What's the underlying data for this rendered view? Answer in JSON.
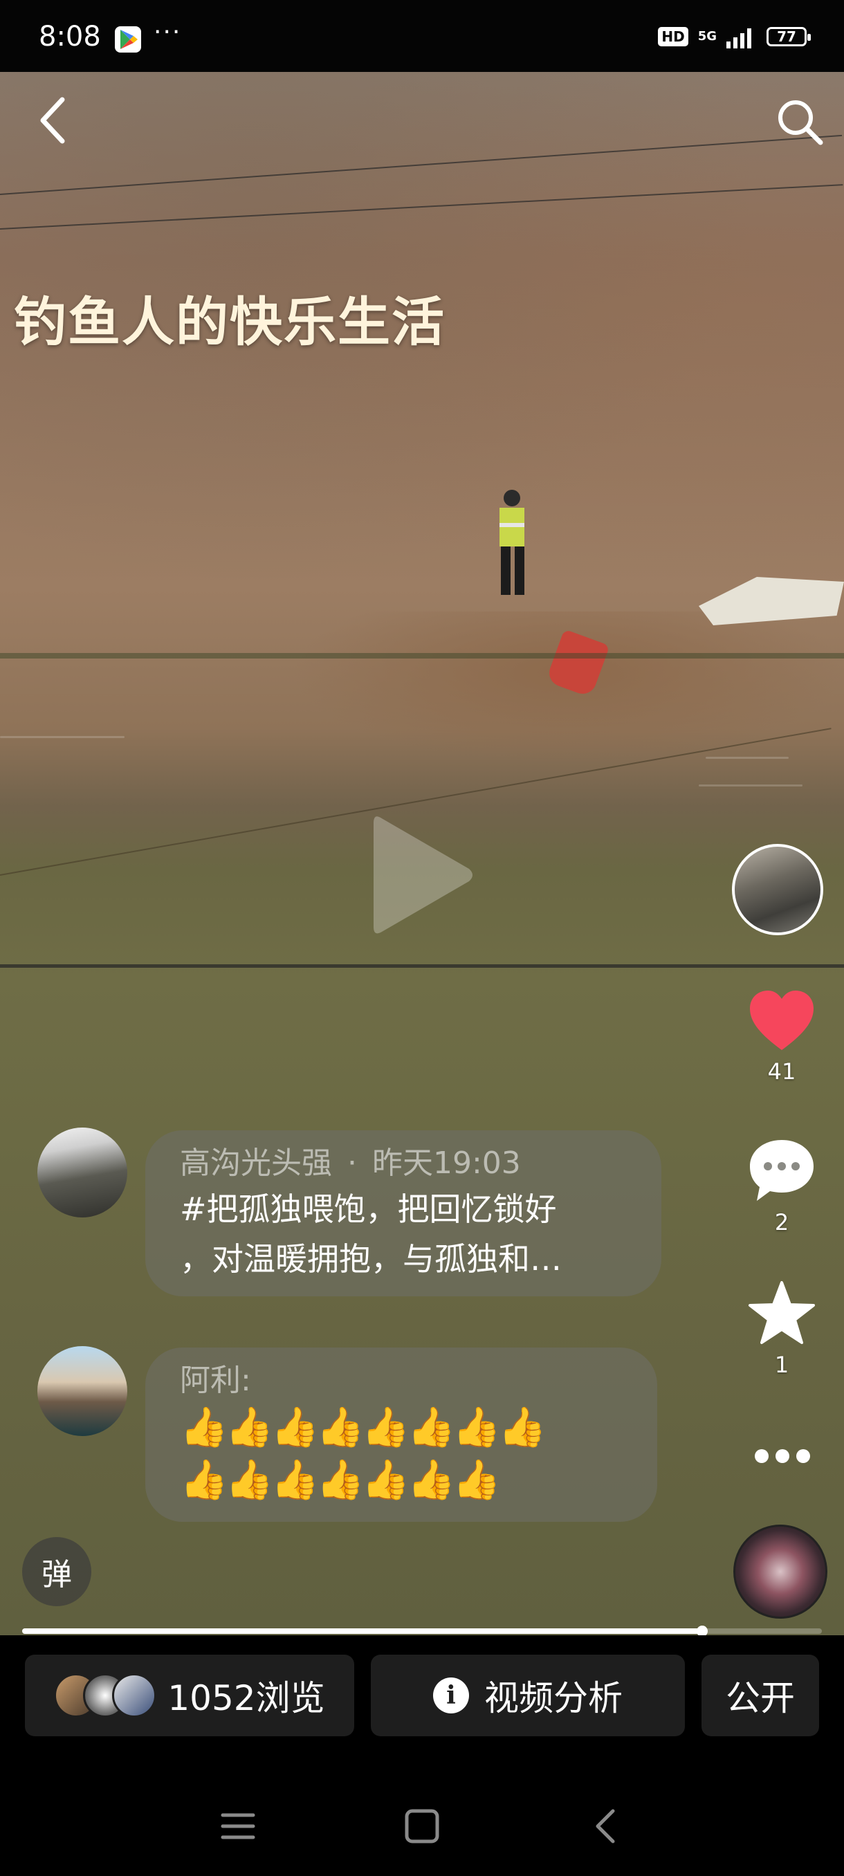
{
  "status_bar": {
    "time": "8:08",
    "more": "···",
    "hd_badge": "HD",
    "network": "5G",
    "battery": "77"
  },
  "video": {
    "title": "钓鱼人的快乐生活",
    "icons": {
      "back": "back-chevron-icon",
      "search": "search-icon",
      "play": "play-icon"
    },
    "progress": 0.85
  },
  "side_actions": {
    "like_count": "41",
    "comment_count": "2",
    "favorite_count": "1",
    "like_color": "#f6465c"
  },
  "comments": [
    {
      "user": "高沟光头强",
      "separator": "·",
      "time": "昨天19:03",
      "line1": "#把孤独喂饱，把回忆锁好",
      "line2": "，对温暖拥抱，与孤独和…"
    },
    {
      "user": "阿利:",
      "emoji_row1": "👍👍👍👍👍👍👍👍",
      "emoji_row2": "👍👍👍👍👍👍👍"
    }
  ],
  "danmaku_label": "弹",
  "bottom_bar": {
    "views_label": "1052浏览",
    "analysis_label": "视频分析",
    "public_label": "公开",
    "info_glyph": "i"
  }
}
